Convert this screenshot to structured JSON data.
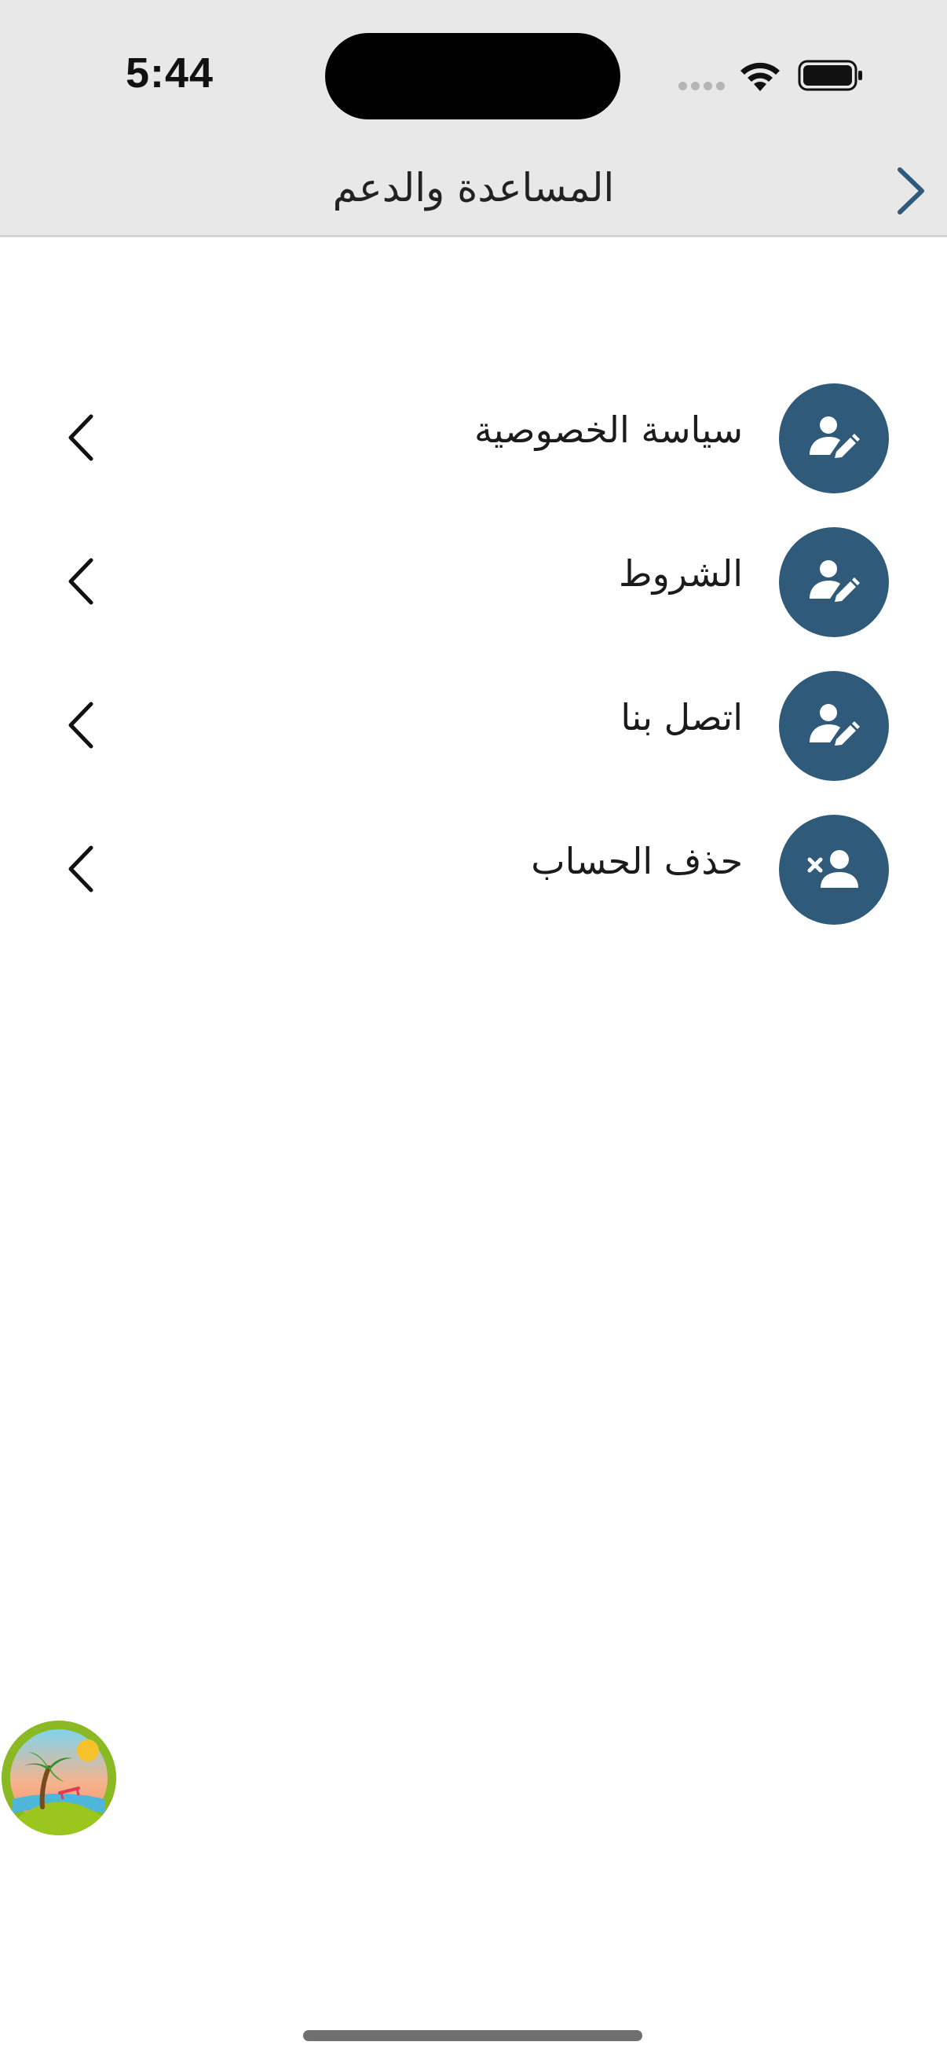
{
  "status_bar": {
    "time": "5:44"
  },
  "nav": {
    "title": "المساعدة والدعم",
    "back_icon": "chevron-right-icon",
    "accent": "#305a7a"
  },
  "menu": {
    "items": [
      {
        "label": "سياسة الخصوصية",
        "icon": "user-edit-icon"
      },
      {
        "label": "الشروط",
        "icon": "user-edit-icon"
      },
      {
        "label": "اتصل بنا",
        "icon": "user-edit-icon"
      },
      {
        "label": "حذف الحساب",
        "icon": "user-remove-icon"
      }
    ],
    "icon_bg": "#305a7a",
    "chevron_icon": "chevron-left-icon"
  },
  "badge": {
    "icon": "beach-palm-logo"
  }
}
